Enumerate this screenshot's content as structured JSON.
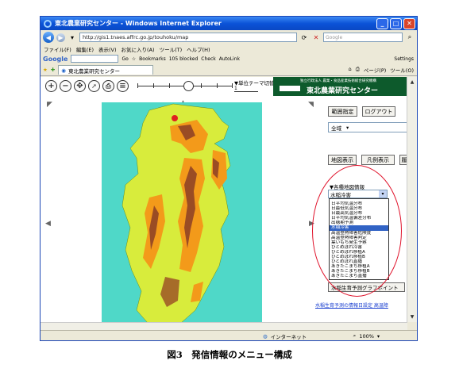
{
  "window": {
    "title": "東北農業研究センター - Windows Internet Explorer",
    "controls": {
      "minimize": "_",
      "maximize": "□",
      "close": "✕"
    }
  },
  "address": {
    "url": "http://gis1.tnaes.affrc.go.jp/touhoku/map",
    "search_placeholder": "Google"
  },
  "menu": [
    "ファイル(F)",
    "編集(E)",
    "表示(V)",
    "お気に入り(A)",
    "ツール(T)",
    "ヘルプ(H)"
  ],
  "google_toolbar": {
    "logo": "Google",
    "go": "Go",
    "bookmarks": "Bookmarks",
    "blocked": "105 blocked",
    "check": "Check",
    "autolink": "AutoLink",
    "settings": "Settings"
  },
  "tab": {
    "label": "東北農業研究センター",
    "page": "ページ(P)",
    "tools": "ツール(O)"
  },
  "map_tools": {
    "theme_label": "▼単位テーマ切替",
    "theme_value": "1",
    "icons": [
      "zoom-in-icon",
      "zoom-out-icon",
      "pan-icon",
      "pointer-icon",
      "print-icon",
      "layer-icon"
    ]
  },
  "banner": {
    "subtitle": "独立行政法人 農業・食品産業技術総合研究機構",
    "name": "東北農業研究センター"
  },
  "panel": {
    "range_button": "範囲指定",
    "logout_button": "ログアウト",
    "region_select": "全域",
    "map_display_button": "地図表示",
    "legend_button": "凡例表示",
    "extra_button": "履",
    "info_title": "▼各種地図情報",
    "dropdown_value": "水稲冷害",
    "dropdown_items": [
      "日平均気温分布",
      "日最低気温分布",
      "日最高気温分布",
      "日平均気温偏差分布",
      "出穂期予測",
      "水稲冷害",
      "高温登熟障害危険度",
      "高温登熟障害判定",
      "葉いもち発生予察",
      "ひとめぼれ冷害",
      "ひとめぼれ移植A",
      "ひとめぼれ移植B",
      "ひとめぼれ直播",
      "あきたこまち移植A",
      "あきたこまち移植B",
      "あきたこまち直播"
    ],
    "selected_index": 5,
    "graph_button": "水稲生育予測グラフポイント",
    "footer_link": "水稲生育予測の情報日設定 高温障"
  },
  "status": {
    "zone": "インターネット",
    "zoom": "100%"
  },
  "caption": "図3　発信情報のメニュー構成",
  "colors": {
    "sea": "#4fd8c8",
    "land": "#d8ec3c",
    "high": "#f39a1a",
    "mountain": "#9a4c24",
    "selection": "#3163c5",
    "oval": "#e0132b",
    "banner": "#0d5a2c"
  }
}
